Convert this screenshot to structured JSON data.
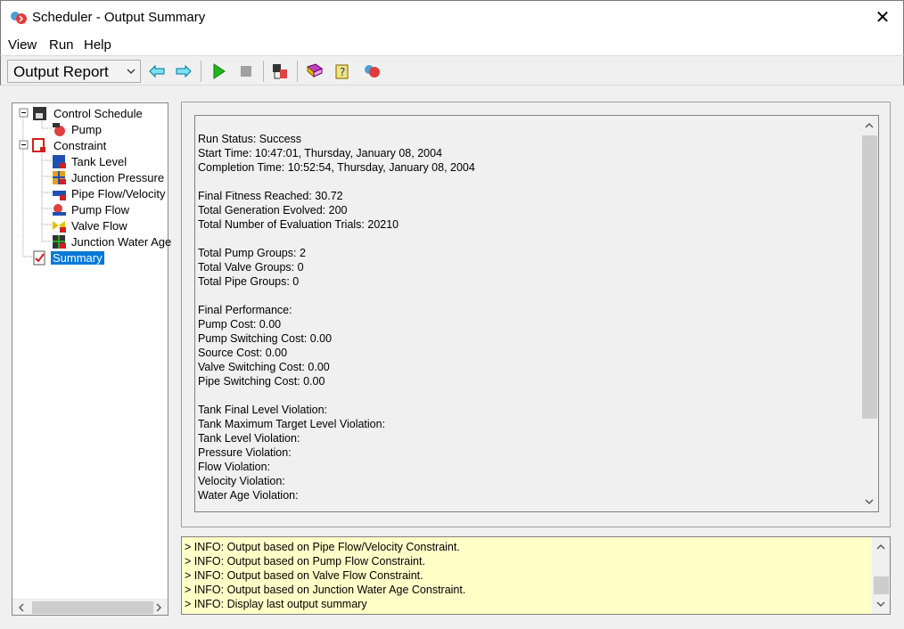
{
  "window": {
    "title": "Scheduler - Output Summary",
    "app_icon": "scheduler-app-icon",
    "close_icon": "close-icon"
  },
  "menu": [
    "View",
    "Run",
    "Help"
  ],
  "toolbar": {
    "combo_value": "Output Report",
    "buttons": [
      "back-arrow-icon",
      "forward-arrow-icon",
      "run-icon",
      "stop-icon",
      "tree-view-icon",
      "book-icon",
      "help-icon",
      "scheduler-icon"
    ]
  },
  "tree": {
    "items": [
      {
        "label": "Control Schedule",
        "icon": "control-schedule-icon"
      },
      {
        "label": "Pump",
        "icon": "pump-icon"
      },
      {
        "label": "Constraint",
        "icon": "constraint-icon"
      },
      {
        "label": "Tank Level",
        "icon": "tank-level-icon"
      },
      {
        "label": "Junction Pressure",
        "icon": "junction-pressure-icon"
      },
      {
        "label": "Pipe Flow/Velocity",
        "icon": "pipe-flow-icon"
      },
      {
        "label": "Pump Flow",
        "icon": "pump-flow-icon"
      },
      {
        "label": "Valve Flow",
        "icon": "valve-flow-icon"
      },
      {
        "label": "Junction Water Age",
        "icon": "junction-water-age-icon"
      },
      {
        "label": "Summary",
        "icon": "summary-icon"
      }
    ]
  },
  "report": {
    "lines": [
      "Run Status: Success",
      "Start Time: 10:47:01, Thursday, January 08, 2004",
      "Completion Time: 10:52:54, Thursday, January 08, 2004",
      "",
      "Final Fitness Reached: 30.72",
      "Total Generation Evolved: 200",
      "Total Number of Evaluation Trials: 20210",
      "",
      "Total Pump Groups: 2",
      "Total Valve Groups: 0",
      "Total Pipe Groups: 0",
      "",
      "Final Performance:",
      "Pump Cost: 0.00",
      "Pump Switching Cost: 0.00",
      "Source Cost: 0.00",
      "Valve Switching Cost: 0.00",
      "Pipe Switching Cost: 0.00",
      "",
      "Tank Final Level Violation:",
      "Tank Maximum Target Level Violation:",
      "Tank Level Violation:",
      "Pressure Violation:",
      "Flow Violation:",
      "Velocity Violation:",
      "Water Age Violation:"
    ]
  },
  "log": {
    "lines": [
      "> INFO: Output based on Pipe Flow/Velocity Constraint.",
      "> INFO: Output based on Pump Flow Constraint.",
      "> INFO: Output based on Valve Flow Constraint.",
      "> INFO: Output based on Junction Water Age Constraint.",
      "> INFO: Display last output summary"
    ]
  },
  "colors": {
    "selection": "#0078d7",
    "log_background": "#ffffc8"
  }
}
